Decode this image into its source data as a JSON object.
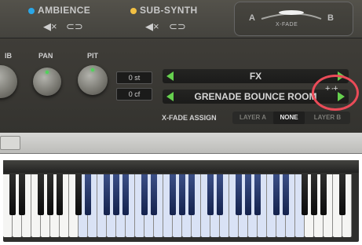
{
  "layers": {
    "layer1": {
      "name": "AMBIENCE",
      "dot_color": "#2aa7e8"
    },
    "layer2": {
      "name": "SUB-SYNTH",
      "dot_color": "#f2c043"
    },
    "mute_icon": "speaker-mute-icon",
    "link_icon": "link-icon",
    "mute_glyph": "◀×",
    "link_glyph": "⊂⊃"
  },
  "xfade": {
    "left": "A",
    "right": "B",
    "label": "X-FADE"
  },
  "knobs": {
    "labels": [
      "IB",
      "PAN",
      "PIT"
    ]
  },
  "pitch": {
    "coarse": "0 st",
    "fine": "0 cf"
  },
  "selectors": {
    "fx": "FX",
    "room": "GRENADE BOUNCE ROOM"
  },
  "xfade_assign": {
    "label": "X-FADE ASSIGN",
    "options": [
      "LAYER A",
      "NONE",
      "LAYER B"
    ],
    "selected": "NONE"
  },
  "menu_icon": "+ ·+",
  "colors": {
    "accent": "#66d04e",
    "highlight_circle": "#ea4b58",
    "key_range_white": "#d9e2f5",
    "key_range_black": "#23356a"
  }
}
